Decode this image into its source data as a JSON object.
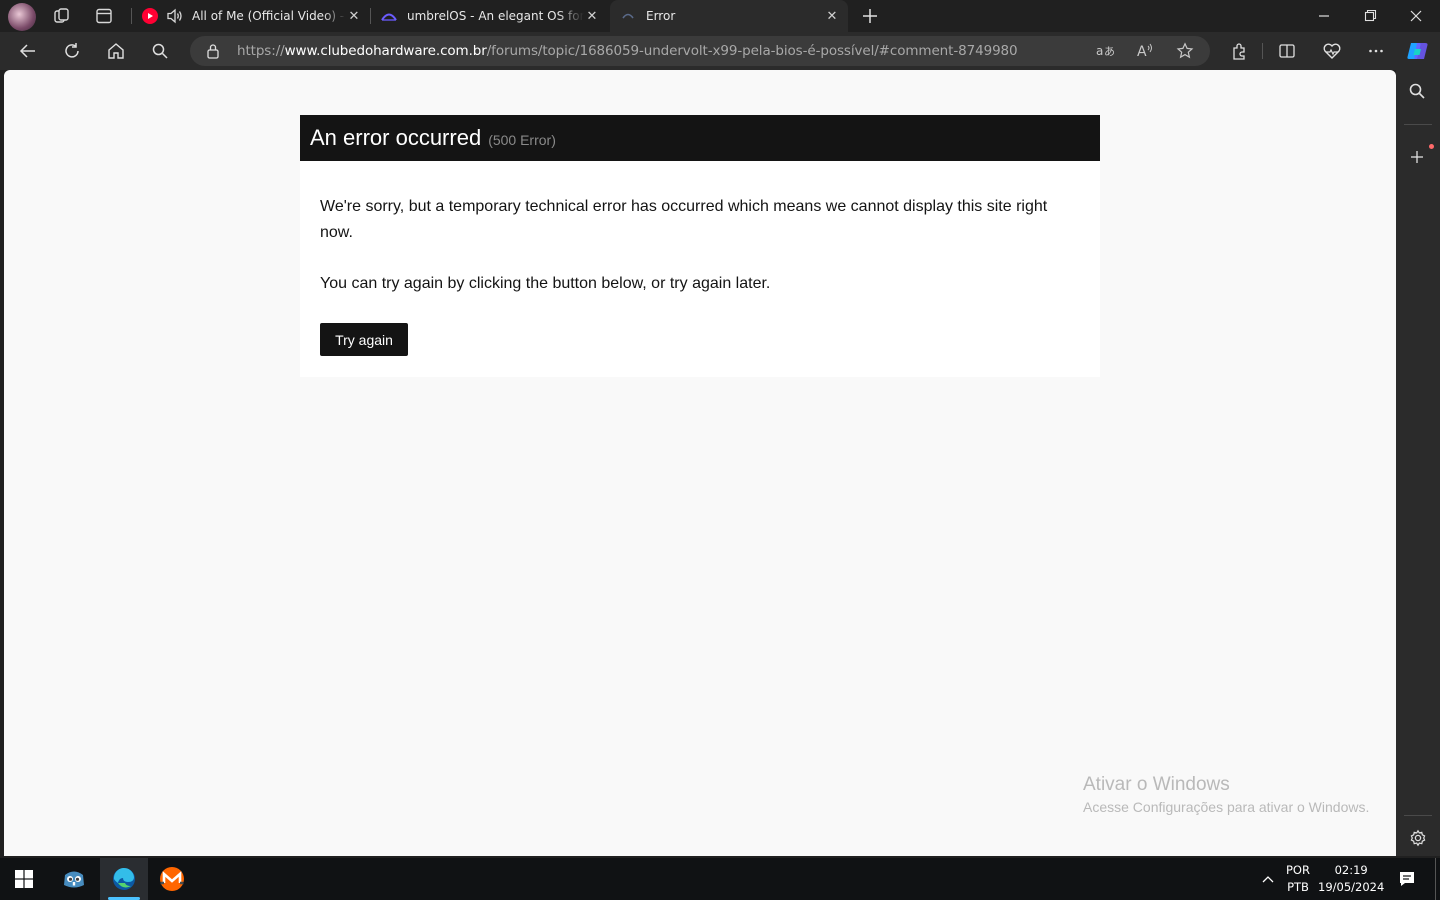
{
  "browser": {
    "tabs": [
      {
        "title": "All of Me (Official Video) - YouTube",
        "state": "playing audio"
      },
      {
        "title": "umbrelOS - An elegant OS for your home server"
      },
      {
        "title": "Error",
        "active": true
      }
    ],
    "url": {
      "scheme": "https://",
      "host": "www.clubedohardware.com.br",
      "path": "/forums/topic/1686059-undervolt-x99-pela-bios-é-possível/#comment-8749980"
    }
  },
  "page": {
    "title": "An error occurred",
    "code": "(500 Error)",
    "message1": "We're sorry, but a temporary technical error has occurred which means we cannot display this site right now.",
    "message2": "You can try again by clicking the button below, or try again later.",
    "button": "Try again"
  },
  "watermark": {
    "line1": "Ativar o Windows",
    "line2": "Acesse Configurações para ativar o Windows."
  },
  "taskbar": {
    "lang1": "POR",
    "lang2": "PTB",
    "time": "02:19",
    "date": "19/05/2024"
  },
  "colors": {
    "accent": "#0078d4",
    "youtube": "#ff0033",
    "error_header": "#141414"
  }
}
